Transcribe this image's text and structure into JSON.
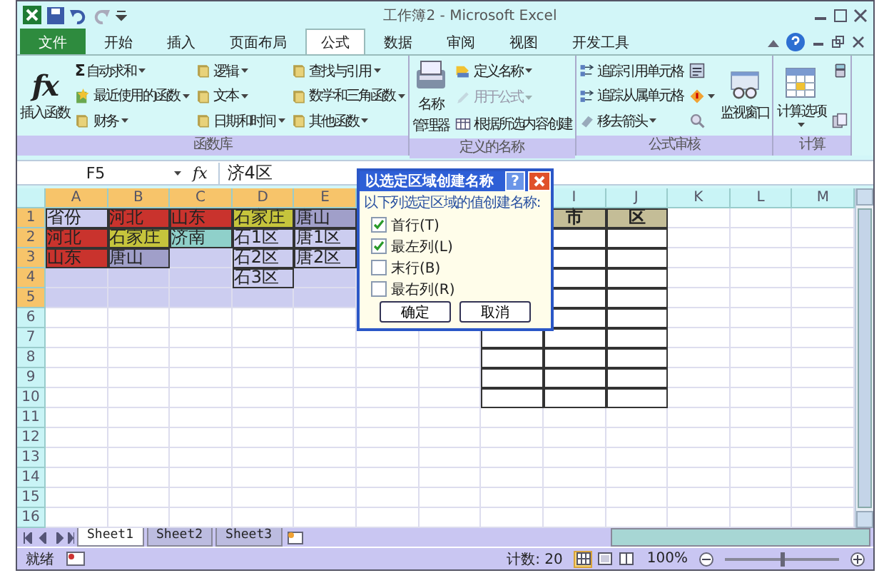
{
  "window": {
    "title": "工作簿2 - Microsoft Excel"
  },
  "ribbon": {
    "tabs": [
      {
        "label": "文件",
        "kind": "file",
        "selected": false
      },
      {
        "label": "开始",
        "kind": "tab",
        "selected": false
      },
      {
        "label": "插入",
        "kind": "tab",
        "selected": false
      },
      {
        "label": "页面布局",
        "kind": "tab",
        "selected": false
      },
      {
        "label": "公式",
        "kind": "tab",
        "selected": true
      },
      {
        "label": "数据",
        "kind": "tab",
        "selected": false
      },
      {
        "label": "审阅",
        "kind": "tab",
        "selected": false
      },
      {
        "label": "视图",
        "kind": "tab",
        "selected": false
      },
      {
        "label": "开发工具",
        "kind": "tab",
        "selected": false
      }
    ],
    "groups": [
      {
        "label": "函数库",
        "large": [
          {
            "lines": [
              "插入函数"
            ],
            "glyph": "fx",
            "dropdown": false
          }
        ],
        "columns": [
          [
            {
              "label": "自动求和",
              "glyph": "Σ",
              "dropdown": true,
              "disabled": false
            },
            {
              "label": "最近使用的函数",
              "kind": "star",
              "dropdown": true,
              "disabled": false
            },
            {
              "label": "财务",
              "kind": "book",
              "dropdown": true,
              "disabled": false
            }
          ],
          [
            {
              "label": "逻辑",
              "kind": "book",
              "dropdown": true,
              "disabled": false
            },
            {
              "label": "文本",
              "kind": "book",
              "dropdown": true,
              "disabled": false
            },
            {
              "label": "日期和时间",
              "kind": "book",
              "dropdown": true,
              "disabled": false
            }
          ],
          [
            {
              "label": "查找与引用",
              "kind": "book",
              "dropdown": true,
              "disabled": false
            },
            {
              "label": "数学和三角函数",
              "kind": "book",
              "dropdown": true,
              "disabled": false
            },
            {
              "label": "其他函数",
              "kind": "book",
              "dropdown": true,
              "disabled": false
            }
          ]
        ]
      },
      {
        "label": "定义的名称",
        "large": [
          {
            "lines": [
              "名称",
              "管理器"
            ],
            "kind": "names",
            "dropdown": false
          }
        ],
        "columns": [
          [
            {
              "label": "定义名称",
              "kind": "tag",
              "dropdown": true,
              "disabled": false
            },
            {
              "label": "用于公式",
              "kind": "pencil",
              "dropdown": true,
              "disabled": true
            },
            {
              "label": "根据所选内容创建",
              "kind": "table",
              "dropdown": false,
              "disabled": false
            }
          ]
        ]
      },
      {
        "label": "公式审核",
        "columns": [
          [
            {
              "label": "追踪引用单元格",
              "kind": "arrows",
              "dropdown": false,
              "disabled": false
            },
            {
              "label": "追踪从属单元格",
              "kind": "arrows",
              "dropdown": false,
              "disabled": false
            },
            {
              "label": "移去箭头",
              "kind": "eraser",
              "dropdown": true,
              "disabled": false
            }
          ],
          [
            {
              "kind": "formulas",
              "dropdown": false,
              "disabled": false
            },
            {
              "kind": "warning",
              "dropdown": true,
              "disabled": false
            },
            {
              "kind": "magnifier",
              "dropdown": false,
              "disabled": false
            }
          ]
        ],
        "large_after": [
          {
            "lines": [
              "监视窗口"
            ],
            "kind": "glasses",
            "dropdown": false
          }
        ]
      },
      {
        "label": "计算",
        "large": [
          {
            "lines": [
              "计算选项"
            ],
            "kind": "sheet",
            "dropdown": true
          }
        ],
        "columns": [
          [
            {
              "kind": "calculator",
              "dropdown": false,
              "disabled": false
            },
            {
              "kind": "pages",
              "dropdown": false,
              "disabled": false
            }
          ]
        ]
      }
    ]
  },
  "formula_bar": {
    "name_box": "F5",
    "fx": "fx",
    "formula": "济4区"
  },
  "sheet": {
    "columns": [
      {
        "label": "A",
        "selected": true
      },
      {
        "label": "B",
        "selected": true
      },
      {
        "label": "C",
        "selected": true
      },
      {
        "label": "D",
        "selected": true
      },
      {
        "label": "E",
        "selected": true
      },
      {},
      {},
      {},
      {
        "label": "I",
        "selected": false
      },
      {
        "label": "J",
        "selected": false
      },
      {
        "label": "K",
        "selected": false
      },
      {
        "label": "L",
        "selected": false
      },
      {
        "label": "M",
        "selected": false
      }
    ],
    "rows": [
      {
        "label": "1",
        "selected": true,
        "cells": [
          {
            "text": "省份",
            "bordered": true
          },
          {
            "text": "河北",
            "color": "#c9332d",
            "bordered": true
          },
          {
            "text": "山东",
            "color": "#c9332d",
            "bordered": true
          },
          {
            "text": "石家庄",
            "color": "#c6c43c",
            "bordered": true
          },
          {
            "text": "唐山",
            "color": "#a09fc9",
            "bordered": true
          },
          {},
          {},
          {},
          {
            "text": "市",
            "color": "#c4bd97",
            "bordered": true,
            "bold": true
          },
          {
            "text": "区",
            "color": "#c4bd97",
            "bordered": true,
            "bold": true
          }
        ]
      },
      {
        "label": "2",
        "selected": true,
        "cells": [
          {
            "text": "河北",
            "color": "#c9332d",
            "bordered": true
          },
          {
            "text": "石家庄",
            "color": "#c6c43c",
            "bordered": true
          },
          {
            "text": "济南",
            "color": "#8fd0ca",
            "bordered": true
          },
          {
            "text": "石1区",
            "bordered": true
          },
          {
            "text": "唐1区",
            "bordered": true
          },
          {},
          {},
          {},
          {
            "bordered": true
          },
          {
            "bordered": true
          }
        ]
      },
      {
        "label": "3",
        "selected": true,
        "cells": [
          {
            "text": "山东",
            "color": "#c9332d",
            "bordered": true
          },
          {
            "text": "唐山",
            "color": "#a09fc9",
            "bordered": true
          },
          {},
          {
            "text": "石2区",
            "bordered": true
          },
          {
            "text": "唐2区",
            "bordered": true
          },
          {},
          {},
          {},
          {
            "bordered": true
          },
          {
            "bordered": true
          }
        ]
      },
      {
        "label": "4",
        "selected": true,
        "cells": [
          {},
          {},
          {},
          {
            "text": "石3区",
            "bordered": true
          },
          {},
          {},
          {},
          {},
          {
            "bordered": true
          },
          {
            "bordered": true
          }
        ]
      },
      {
        "label": "5",
        "selected": true,
        "cells": [
          {},
          {},
          {},
          {},
          {},
          {},
          {},
          {},
          {
            "bordered": true
          },
          {
            "bordered": true
          }
        ]
      },
      {
        "label": "6",
        "selected": false,
        "cells": [
          {},
          {},
          {},
          {},
          {},
          {},
          {},
          {},
          {
            "bordered": true
          },
          {
            "bordered": true
          }
        ]
      },
      {
        "label": "7",
        "selected": false,
        "cells": [
          {},
          {},
          {},
          {},
          {},
          {},
          {},
          {
            "bordered": true
          },
          {
            "bordered": true
          },
          {
            "bordered": true
          }
        ]
      },
      {
        "label": "8",
        "selected": false,
        "cells": [
          {},
          {},
          {},
          {},
          {},
          {},
          {},
          {
            "bordered": true
          },
          {
            "bordered": true
          },
          {
            "bordered": true
          }
        ]
      },
      {
        "label": "9",
        "selected": false,
        "cells": [
          {},
          {},
          {},
          {},
          {},
          {},
          {},
          {
            "bordered": true
          },
          {
            "bordered": true
          },
          {
            "bordered": true
          }
        ]
      },
      {
        "label": "10",
        "selected": false,
        "cells": [
          {},
          {},
          {},
          {},
          {},
          {},
          {},
          {
            "bordered": true
          },
          {
            "bordered": true
          },
          {
            "bordered": true
          }
        ]
      },
      {
        "label": "11",
        "selected": false
      },
      {
        "label": "12",
        "selected": false
      },
      {
        "label": "13",
        "selected": false
      },
      {
        "label": "14",
        "selected": false
      },
      {
        "label": "15",
        "selected": false
      },
      {
        "label": "16",
        "selected": false
      }
    ]
  },
  "dialog": {
    "title": "以选定区域创建名称",
    "help": "?",
    "prompt": "以下列选定区域的值创建名称:",
    "options": [
      {
        "label": "首行(T)",
        "checked": true
      },
      {
        "label": "最左列(L)",
        "checked": true
      },
      {
        "label": "末行(B)",
        "checked": false
      },
      {
        "label": "最右列(R)",
        "checked": false
      }
    ],
    "buttons": [
      "确定",
      "取消"
    ]
  },
  "sheet_tabs": [
    {
      "label": "Sheet1",
      "selected": true
    },
    {
      "label": "Sheet2",
      "selected": false
    },
    {
      "label": "Sheet3",
      "selected": false
    }
  ],
  "status_bar": {
    "mode": "就绪",
    "count": "计数: 20",
    "views": [
      {
        "kind": "normal",
        "selected": true
      },
      {
        "kind": "layout",
        "selected": false
      },
      {
        "kind": "pagebreak",
        "selected": false
      }
    ],
    "zoom": "100%",
    "zoom_slider": {
      "level": 0.5
    }
  }
}
